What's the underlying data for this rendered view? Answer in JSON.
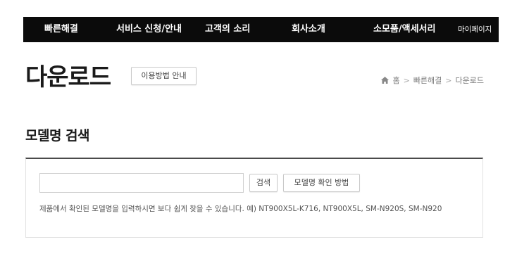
{
  "nav": {
    "items": [
      "빠른해결",
      "서비스 신청/안내",
      "고객의 소리",
      "회사소개",
      "소모품/액세서리",
      "마이페이지"
    ]
  },
  "page": {
    "title": "다운로드",
    "guide_button": "이용방법 안내"
  },
  "breadcrumb": {
    "home": "홈",
    "items": [
      "빠른해결",
      "다운로드"
    ]
  },
  "search": {
    "section_title": "모델명 검색",
    "input_value": "",
    "placeholder": "",
    "search_button": "검색",
    "howto_button": "모델명 확인 방법",
    "helper_text": "제품에서 확인된 모델명을 입력하시면 보다 쉽게 찾을 수 있습니다. 예) NT900X5L-K716, NT900X5L, SM-N920S, SM-N920"
  },
  "icons": {
    "home": "home-icon"
  }
}
